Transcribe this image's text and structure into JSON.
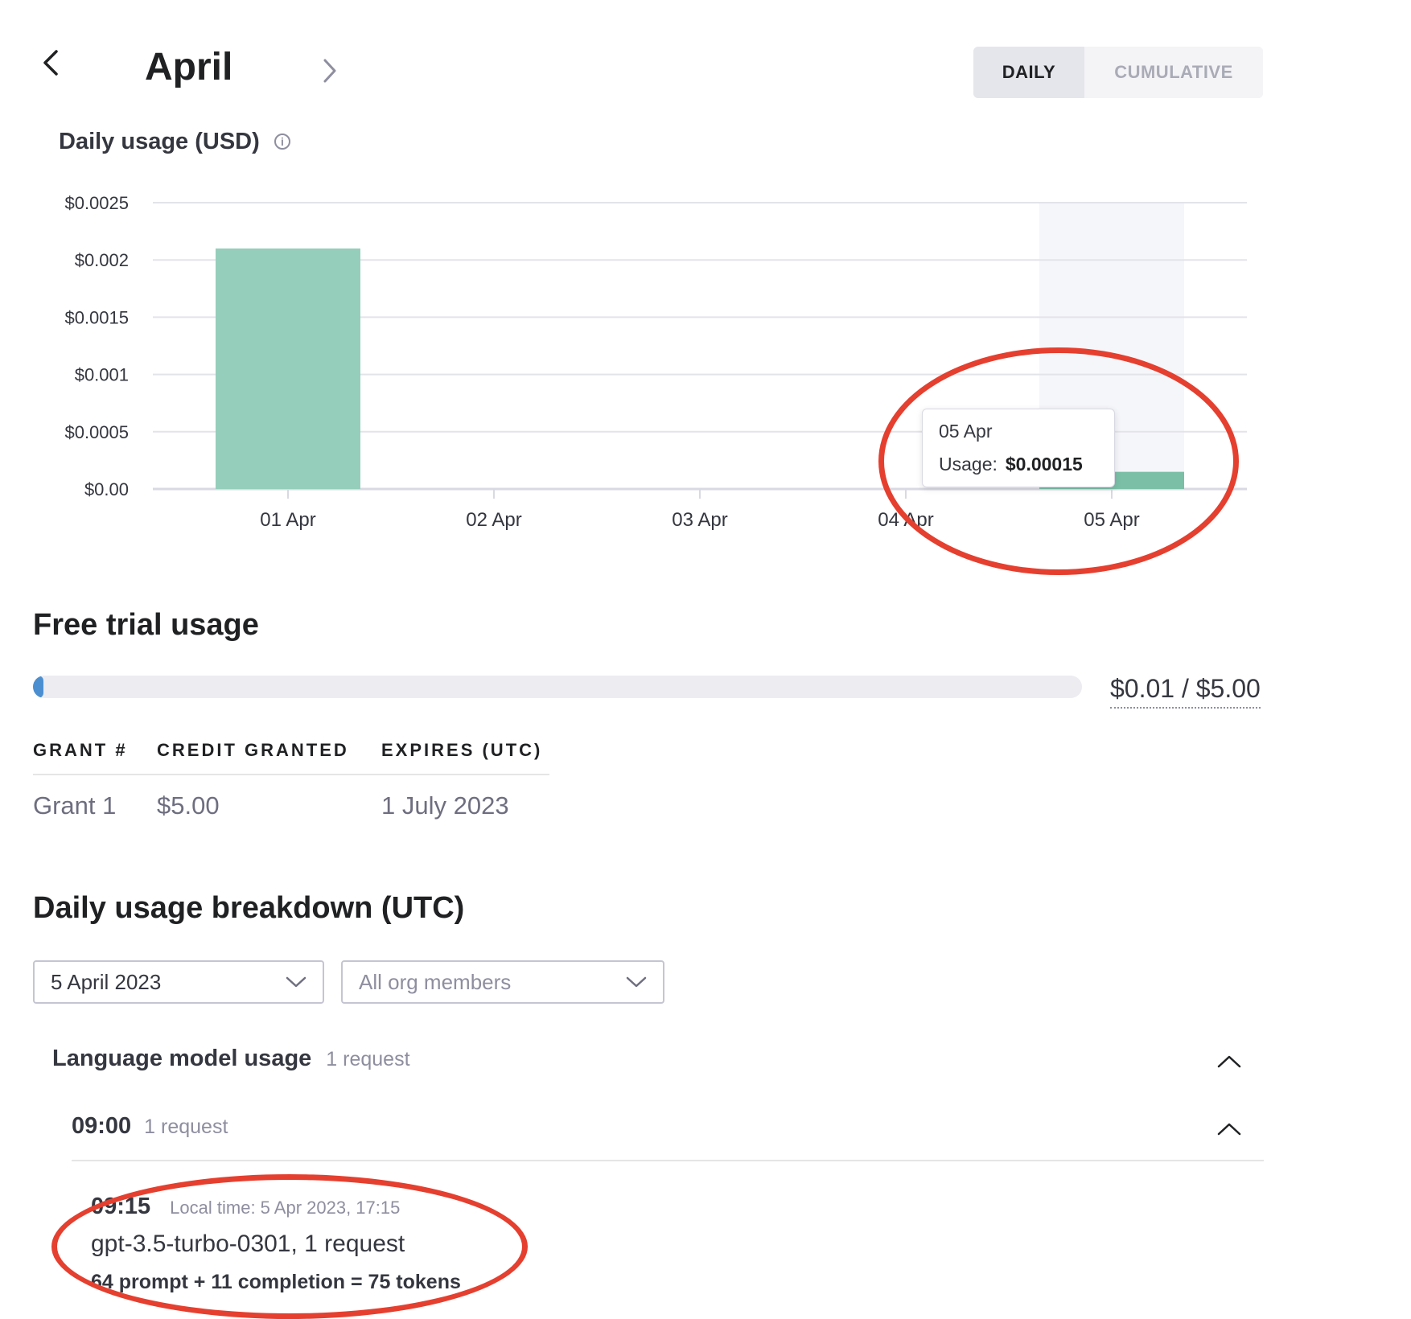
{
  "header": {
    "prev_label": "previous month",
    "month": "April",
    "next_label": "next month",
    "toggle": {
      "daily": "DAILY",
      "cumulative": "CUMULATIVE",
      "active": "daily"
    }
  },
  "chart_title": "Daily usage (USD)",
  "chart_data": {
    "type": "bar",
    "title": "Daily usage (USD)",
    "categories": [
      "01 Apr",
      "02 Apr",
      "03 Apr",
      "04 Apr",
      "05 Apr"
    ],
    "values": [
      0.0021,
      0,
      0,
      0,
      0.00015
    ],
    "ylim": [
      0,
      0.0025
    ],
    "yticks": [
      "$0.00",
      "$0.0005",
      "$0.001",
      "$0.0015",
      "$0.002",
      "$0.0025"
    ],
    "grid": true,
    "bar_color": "#95cebb",
    "highlight_category": "05 Apr",
    "highlight_bar_color": "#7bbfa7"
  },
  "tooltip": {
    "date": "05 Apr",
    "label": "Usage:",
    "value": "$0.00015"
  },
  "free_trial": {
    "title": "Free trial usage",
    "used_fraction": 0.002,
    "label": "$0.01 / $5.00",
    "headers": [
      "GRANT #",
      "CREDIT GRANTED",
      "EXPIRES (UTC)"
    ],
    "rows": [
      [
        "Grant 1",
        "$5.00",
        "1 July 2023"
      ]
    ]
  },
  "breakdown": {
    "title": "Daily usage breakdown (UTC)",
    "date_select": "5 April 2023",
    "members_select": "All org members",
    "language_group": {
      "title": "Language model usage",
      "count": "1 request"
    },
    "hour_group": {
      "time": "09:00",
      "count": "1 request"
    },
    "entry": {
      "time": "09:15",
      "local_time": "Local time: 5 Apr 2023, 17:15",
      "model": "gpt-3.5-turbo-0301, 1 request",
      "tokens": "64 prompt + 11 completion = 75 tokens"
    }
  },
  "colors": {
    "accent_annotation": "#e53f2f",
    "progress": "#4c8fd1"
  }
}
